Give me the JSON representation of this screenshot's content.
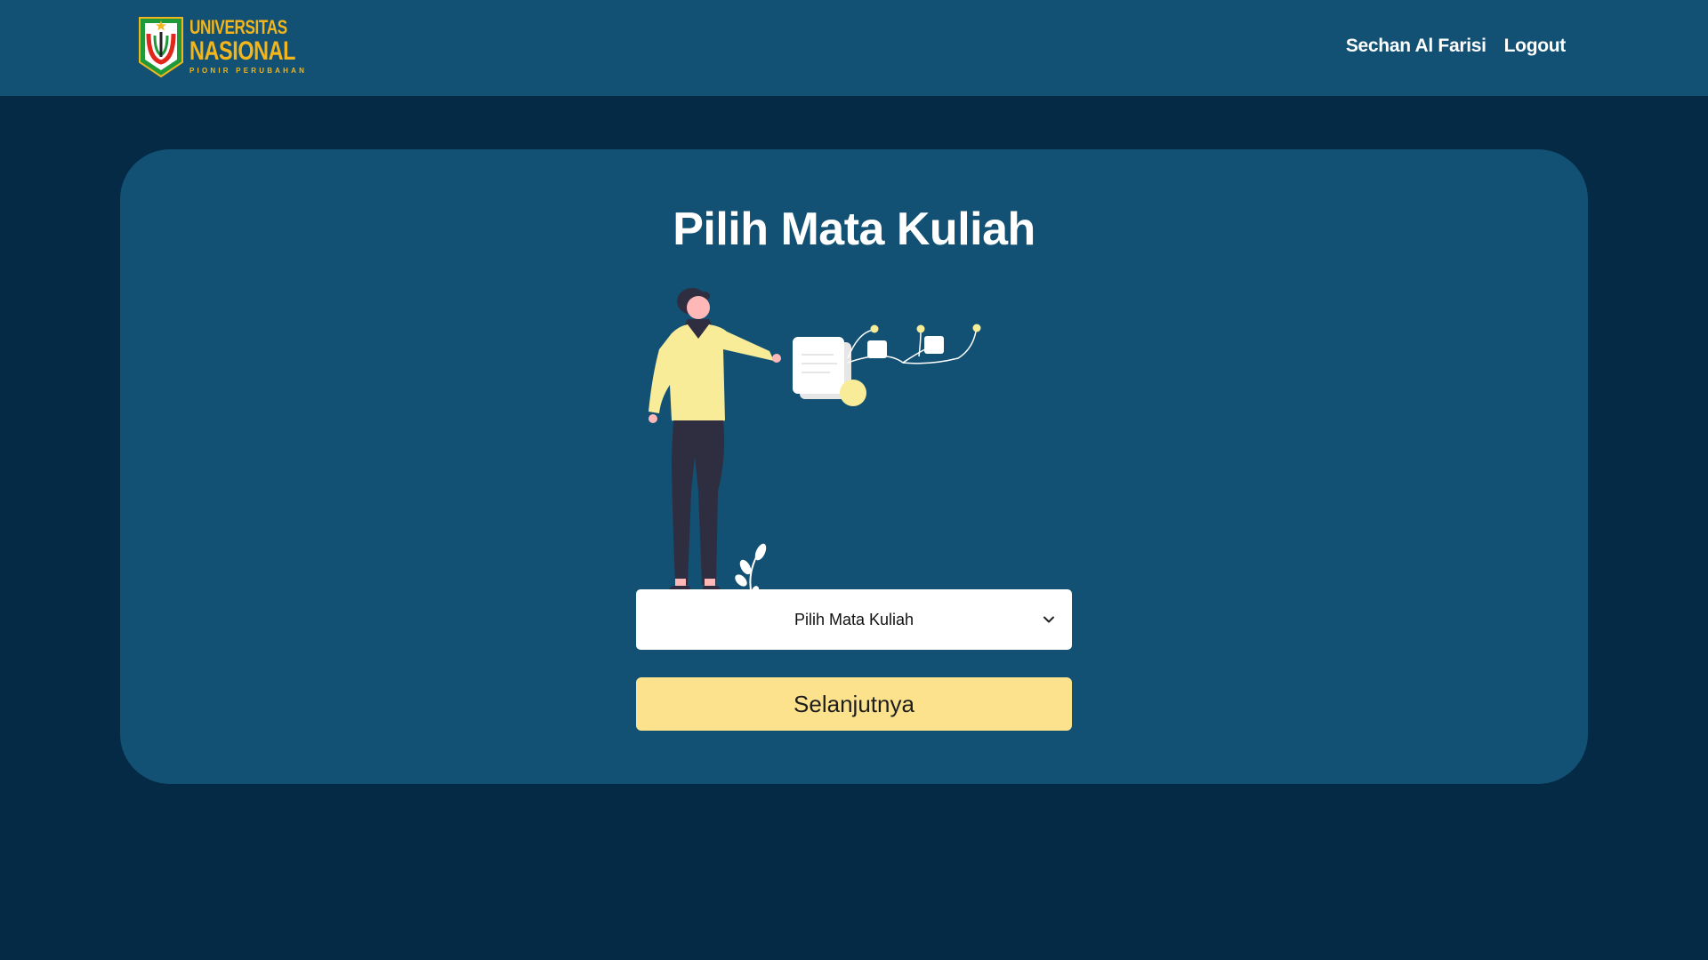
{
  "header": {
    "logo": {
      "line1": "UNIVERSITAS",
      "line2": "NASIONAL",
      "line3": "PIONIR PERUBAHAN"
    },
    "user_name": "Sechan Al Farisi",
    "logout_label": "Logout"
  },
  "main": {
    "title": "Pilih Mata Kuliah",
    "select": {
      "selected_value": "Pilih Mata Kuliah",
      "icon": "chevron-down-icon"
    },
    "next_label": "Selanjutnya"
  },
  "colors": {
    "background": "#042A45",
    "navbar": "#125173",
    "card": "#125173",
    "logo_gold": "#F2B51C",
    "button": "#FDE28D",
    "shirt": "#F9EC98",
    "pants": "#2F2E41"
  }
}
